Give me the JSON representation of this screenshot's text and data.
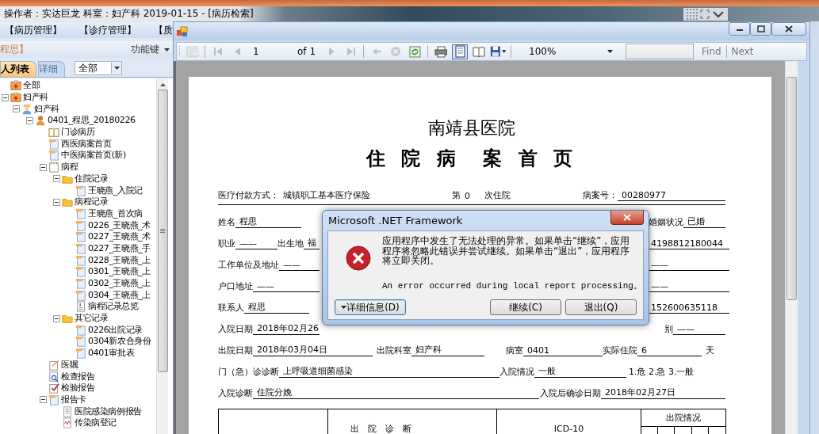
{
  "app_title": "操作者：实达巨龙  科室：妇产科  2019-01-15 - [病历检索]",
  "nav_panel": {
    "menu_items": [
      "【病历管理】",
      "【诊疗管理】",
      "【质"
    ],
    "header": {
      "title": "程思】",
      "function_key": "功能键"
    },
    "tabs": [
      {
        "label": "人列表",
        "selected": true
      },
      {
        "label": "详细",
        "selected": false
      }
    ],
    "filter": {
      "value": "全部"
    },
    "tree": [
      {
        "label": "全部",
        "kind": "dept"
      },
      {
        "label": "妇产科",
        "kind": "dept",
        "expanded": true,
        "children": [
          {
            "label": "妇产科",
            "kind": "doctor",
            "expanded": true,
            "children": [
              {
                "label": "0401_程思_20180226",
                "kind": "person",
                "expanded": true,
                "children": [
                  {
                    "label": "门诊病历",
                    "kind": "book"
                  },
                  {
                    "label": "西医病案首页",
                    "kind": "doc"
                  },
                  {
                    "label": "中医病案首页(新)",
                    "kind": "doc"
                  },
                  {
                    "label": "病程",
                    "kind": "calendar",
                    "expanded": true,
                    "children": [
                      {
                        "label": "住院记录",
                        "kind": "folder",
                        "expanded": true,
                        "children": [
                          {
                            "label": "王晓燕_入院记",
                            "kind": "doc"
                          }
                        ]
                      },
                      {
                        "label": "病程记录",
                        "kind": "folder",
                        "expanded": true,
                        "children": [
                          {
                            "label": "王晓燕_首次病",
                            "kind": "doc"
                          },
                          {
                            "label": "0226_王晓燕_术",
                            "kind": "doc"
                          },
                          {
                            "label": "0227_王晓燕_术",
                            "kind": "doc"
                          },
                          {
                            "label": "0227_王晓燕_手",
                            "kind": "doc"
                          },
                          {
                            "label": "0228_王晓燕_上",
                            "kind": "doc"
                          },
                          {
                            "label": "0301_王晓燕_上",
                            "kind": "doc"
                          },
                          {
                            "label": "0302_王晓燕_上",
                            "kind": "doc"
                          },
                          {
                            "label": "0304_王晓燕_上",
                            "kind": "doc"
                          },
                          {
                            "label": "病程记录总览",
                            "kind": "summary"
                          }
                        ]
                      },
                      {
                        "label": "其它记录",
                        "kind": "folder",
                        "expanded": true,
                        "children": [
                          {
                            "label": "0226出院记录",
                            "kind": "doc"
                          },
                          {
                            "label": "0304新农合身份",
                            "kind": "doc"
                          },
                          {
                            "label": "0401审批表",
                            "kind": "doc"
                          }
                        ]
                      }
                    ]
                  },
                  {
                    "label": "医嘱",
                    "kind": "note"
                  },
                  {
                    "label": "检查报告",
                    "kind": "exam"
                  },
                  {
                    "label": "检验报告",
                    "kind": "lab"
                  },
                  {
                    "label": "报告卡",
                    "kind": "card",
                    "expanded": true,
                    "children": [
                      {
                        "label": "医院感染病例报告",
                        "kind": "report"
                      },
                      {
                        "label": "传染病登记",
                        "kind": "chart"
                      }
                    ]
                  }
                ]
              }
            ]
          }
        ]
      }
    ]
  },
  "report_window": {
    "toolbar": [
      {
        "kind": "thumb",
        "disabled": true
      },
      {
        "kind": "separator"
      },
      {
        "kind": "first",
        "disabled": true
      },
      {
        "kind": "prev",
        "disabled": true
      },
      {
        "kind": "page-field",
        "value": "1"
      },
      {
        "kind": "label",
        "text": "of 1"
      },
      {
        "kind": "next",
        "disabled": true
      },
      {
        "kind": "last",
        "disabled": true
      },
      {
        "kind": "separator"
      },
      {
        "kind": "back",
        "disabled": true
      },
      {
        "kind": "stop",
        "disabled": true
      },
      {
        "kind": "refresh",
        "disabled": false
      },
      {
        "kind": "separator"
      },
      {
        "kind": "print",
        "disabled": false
      },
      {
        "kind": "print-layout",
        "disabled": false,
        "on": true
      },
      {
        "kind": "page-setup",
        "disabled": false
      },
      {
        "kind": "export",
        "disabled": false
      },
      {
        "kind": "separator"
      },
      {
        "kind": "zoom",
        "value": "100%"
      },
      {
        "kind": "find-field"
      },
      {
        "kind": "link",
        "text": "Find",
        "disabled": true
      },
      {
        "kind": "separator"
      },
      {
        "kind": "link",
        "text": "Next",
        "disabled": true
      }
    ],
    "page": {
      "hospital": "南靖县医院",
      "title": "住 院 病  案 首 页",
      "rows": [
        [
          {
            "label": "医疗付款方式：",
            "value": "城镇职工基本医疗保险"
          },
          {
            "label": "第",
            "value": "0"
          },
          {
            "label": "次住院"
          },
          {
            "label": "病案号：",
            "value": "00280977"
          }
        ],
        [
          {
            "label": "姓名",
            "value": "程思"
          },
          {
            "label": "婚姻状况",
            "value": "已婚"
          }
        ],
        [
          {
            "label": "职业",
            "value": "——"
          },
          {
            "label": "出生地",
            "value": "福"
          },
          {
            "value": "4198812180044"
          }
        ],
        [
          {
            "label": "工作单位及地址",
            "value": "——"
          },
          {
            "value": "——"
          }
        ],
        [
          {
            "label": "户口地址",
            "value": "——"
          },
          {
            "value": "——"
          }
        ],
        [
          {
            "label": "联系人",
            "value": "程思"
          },
          {
            "value": "152600635118"
          }
        ],
        [
          {
            "label": "入院日期",
            "value": "2018年02月26"
          },
          {
            "label": "别",
            "value": "——"
          }
        ],
        [
          {
            "label": "出院日期",
            "value": "2018年03月04日"
          },
          {
            "label": "出院科室",
            "value": "妇产科"
          },
          {
            "label": "病室",
            "value": "0401"
          },
          {
            "label": "实际住院",
            "value": "6"
          },
          {
            "label": "天"
          }
        ],
        [
          {
            "label": "门（急）诊诊断",
            "value": "上呼吸道细菌感染"
          },
          {
            "label": "入院情况",
            "value": "一般"
          },
          {
            "label": "1.危 2.急 3.一般"
          }
        ],
        [
          {
            "label": "入院诊断",
            "value": "住院分娩"
          },
          {
            "label": "入院后确诊日期",
            "value": "2018年02月27日"
          }
        ]
      ],
      "table_header": {
        "diagnosis": "出　院　诊　断",
        "discharge_status": "出院情况",
        "code": "ICD-10"
      }
    }
  },
  "dialog": {
    "title": "Microsoft .NET Framework",
    "message": "应用程序中发生了无法处理的异常。如果单击“继续”，应用程序将忽略此错误并尝试继续。如果单击“退出”，应用程序将立即关闭。",
    "detail": "An error occurred during local report processing。",
    "buttons": [
      {
        "label": "详细信息(D)",
        "kind": "details",
        "focused": true
      },
      {
        "label": "继续(C)",
        "kind": "action",
        "focused": false
      },
      {
        "label": "退出(Q)",
        "kind": "action",
        "focused": false
      }
    ]
  }
}
